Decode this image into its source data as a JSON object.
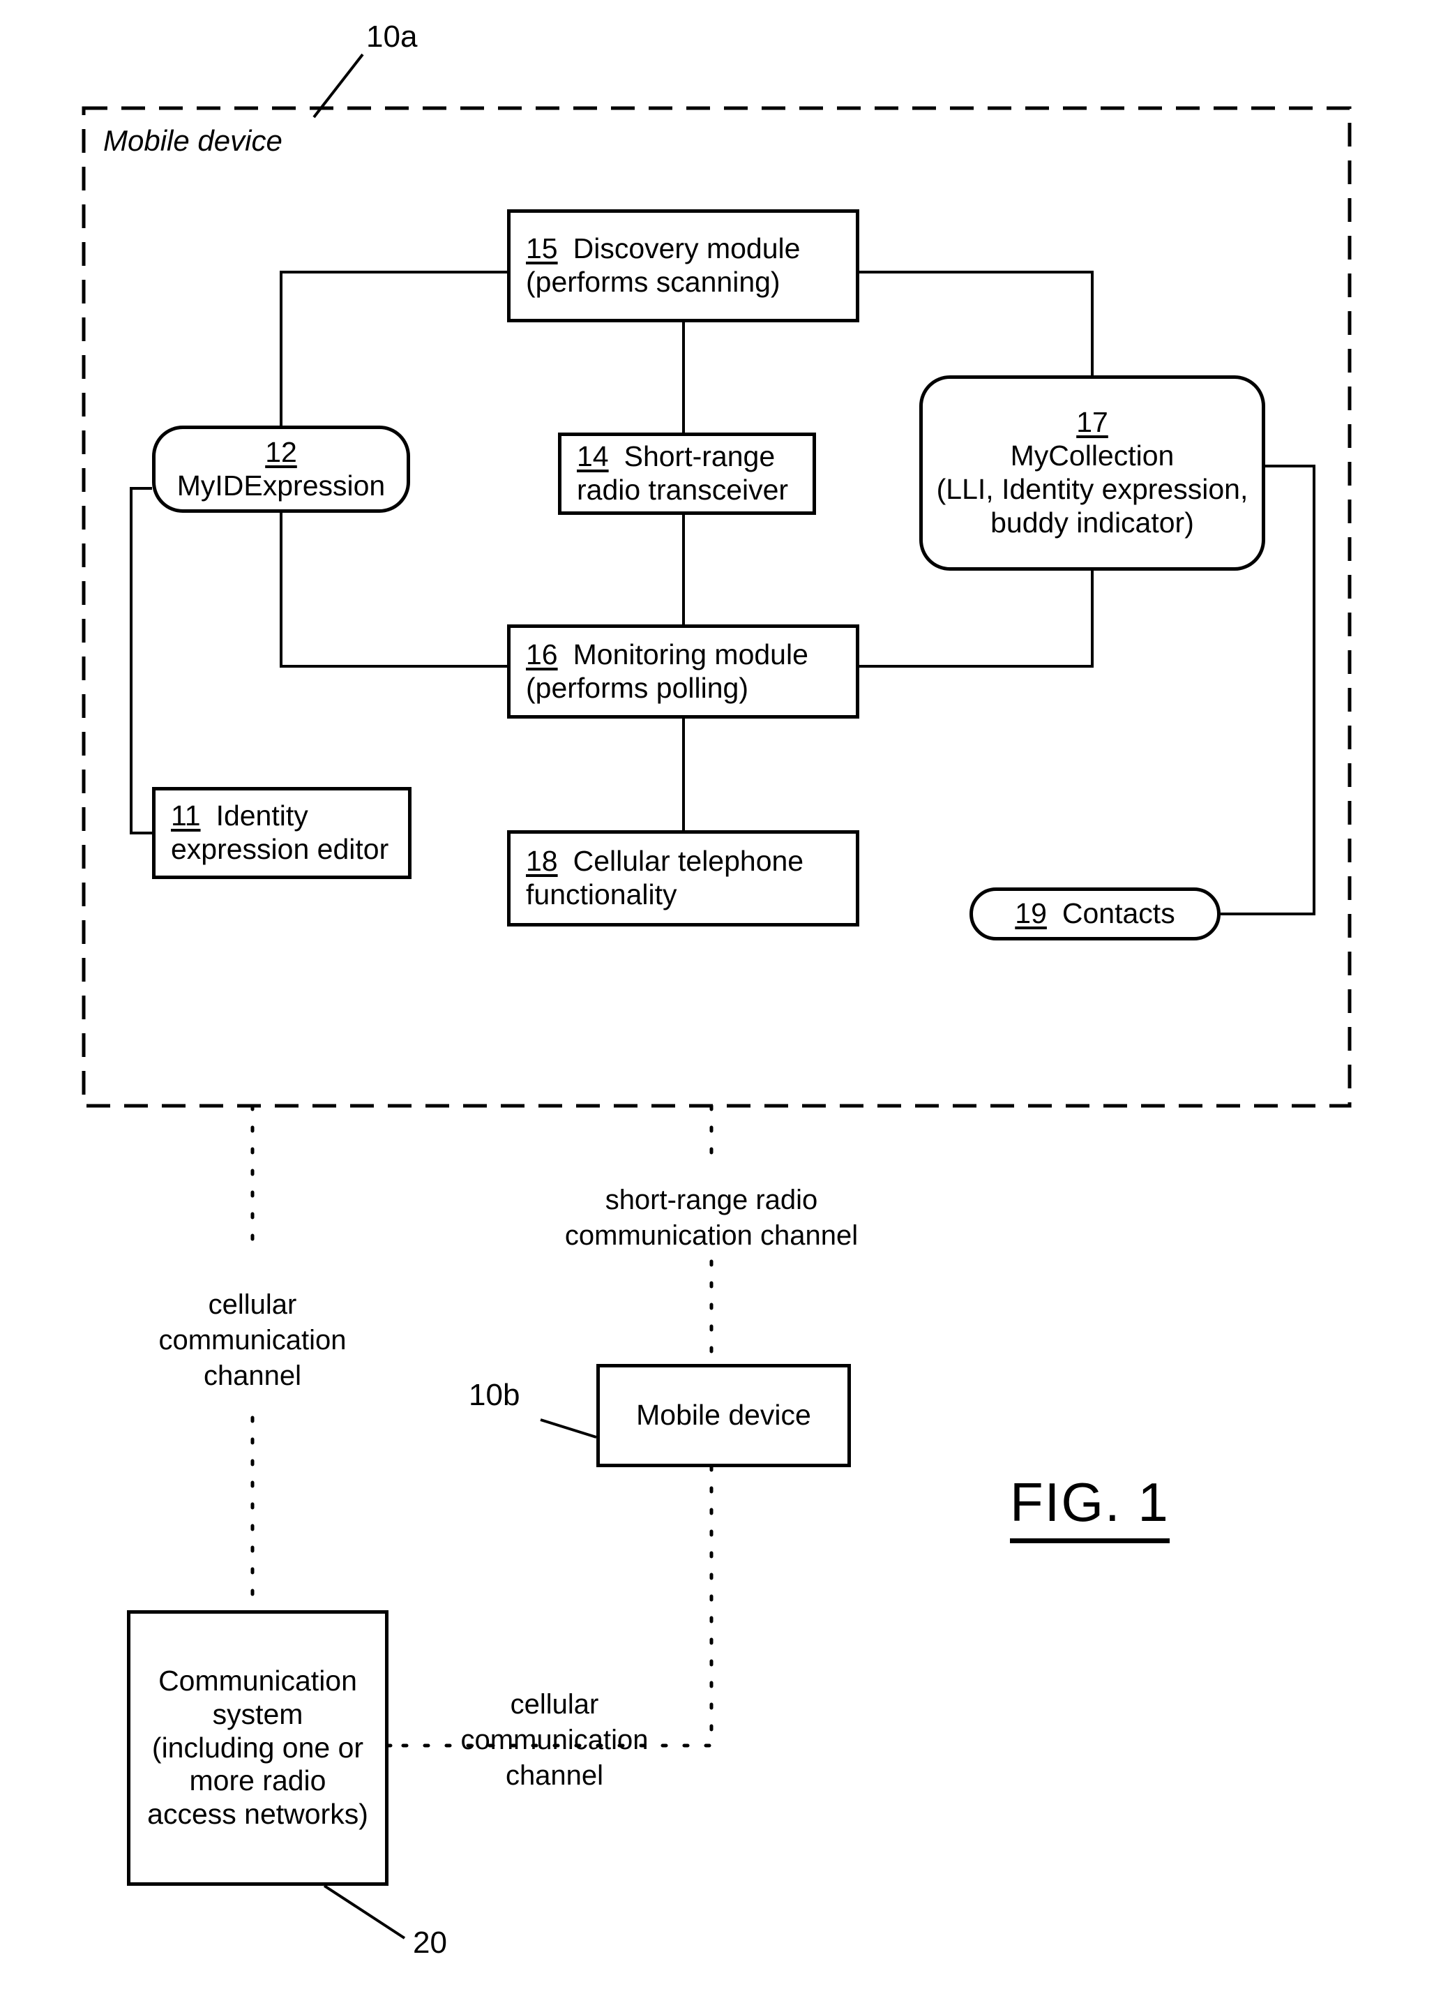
{
  "figure": {
    "title": "FIG. 1",
    "outer_container_label": "Mobile device",
    "outer_container_ref": "10a",
    "bottom_device_ref": "10b",
    "bottom_device_label": "Mobile device",
    "comm_system_ref": "20"
  },
  "blocks": {
    "discovery_module": {
      "ref": "15",
      "line1": "Discovery module",
      "line2": "(performs scanning)"
    },
    "myidexpression": {
      "ref": "12",
      "line1": "MyIDExpression"
    },
    "short_range_transceiver": {
      "ref": "14",
      "line1": "Short-range",
      "line2": "radio transceiver"
    },
    "mycollection": {
      "ref": "17",
      "line1": "MyCollection",
      "line2": "(LLI, Identity expression,",
      "line3": "buddy indicator)"
    },
    "monitoring_module": {
      "ref": "16",
      "line1": "Monitoring  module",
      "line2": "(performs polling)"
    },
    "identity_expression_editor": {
      "ref": "11",
      "line1": "Identity",
      "line2": "expression editor"
    },
    "cellular_telephone_functionality": {
      "ref": "18",
      "line1": "Cellular telephone",
      "line2": "functionality"
    },
    "contacts": {
      "ref": "19",
      "line1": "Contacts"
    },
    "mobile_device_b": {
      "line1": "Mobile device"
    },
    "communication_system": {
      "line1": "Communication",
      "line2": "system",
      "line3": "(including one or",
      "line4": "more radio",
      "line5": "access networks)"
    }
  },
  "channels": {
    "cellular_left": "cellular\ncommunication\nchannel",
    "short_range": "short-range radio\ncommunication channel",
    "cellular_bottom": "cellular\ncommunication\nchannel"
  },
  "colors": {
    "stroke": "#000000",
    "background": "#ffffff"
  }
}
